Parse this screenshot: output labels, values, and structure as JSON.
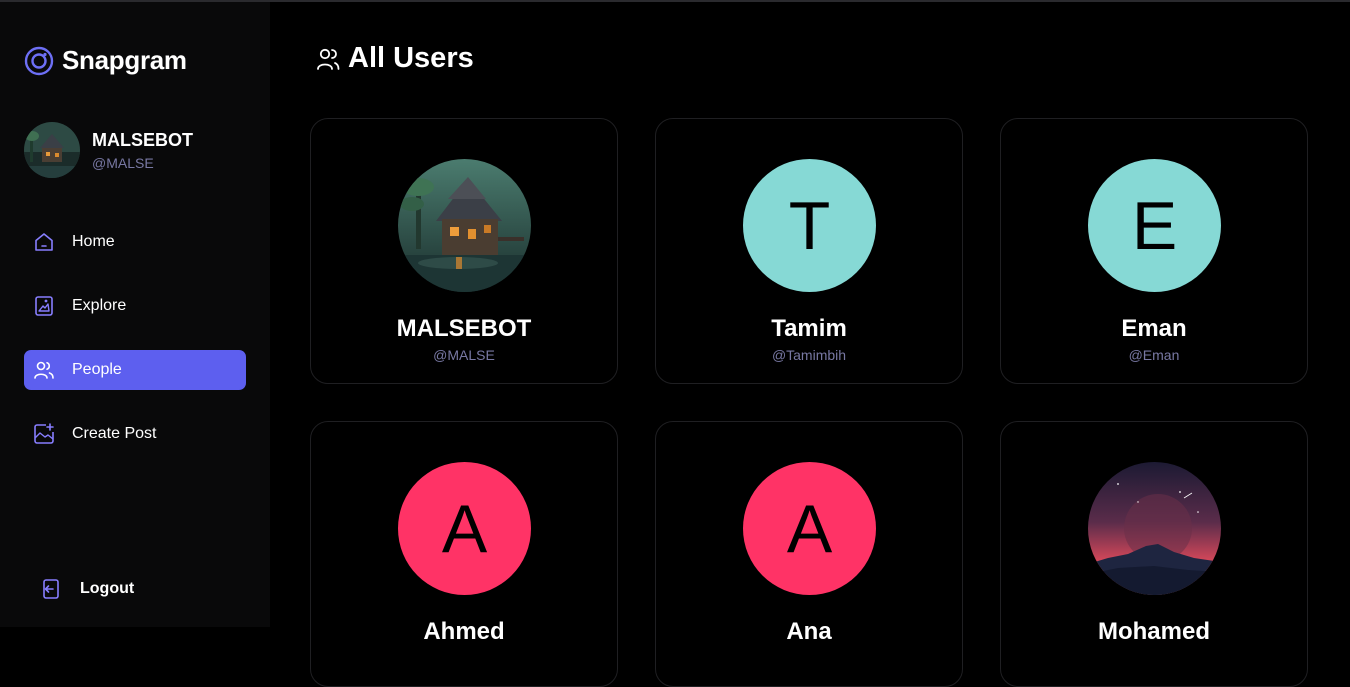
{
  "app": {
    "name": "Snapgram"
  },
  "profile": {
    "name": "MALSEBOT",
    "handle": "@MALSE"
  },
  "nav": {
    "items": [
      {
        "label": "Home",
        "icon": "home-icon",
        "active": false
      },
      {
        "label": "Explore",
        "icon": "explore-icon",
        "active": false
      },
      {
        "label": "People",
        "icon": "people-icon",
        "active": true
      },
      {
        "label": "Create Post",
        "icon": "create-post-icon",
        "active": false
      }
    ],
    "logout": "Logout"
  },
  "page": {
    "title": "All Users",
    "icon": "people-icon"
  },
  "users": [
    {
      "name": "MALSEBOT",
      "handle": "@MALSE",
      "avatar": "image",
      "initial": ""
    },
    {
      "name": "Tamim",
      "handle": "@Tamimbih",
      "avatar": "initial",
      "initial": "T",
      "color": "#86d9d5"
    },
    {
      "name": "Eman",
      "handle": "@Eman",
      "avatar": "initial",
      "initial": "E",
      "color": "#86d9d5"
    },
    {
      "name": "Ahmed",
      "handle": "",
      "avatar": "initial",
      "initial": "A",
      "color": "#ff3366"
    },
    {
      "name": "Ana",
      "handle": "",
      "avatar": "initial",
      "initial": "A",
      "color": "#ff3366"
    },
    {
      "name": "Mohamed",
      "handle": "",
      "avatar": "image",
      "initial": ""
    }
  ],
  "colors": {
    "accent": "#5d5fef",
    "handle": "#7878a3",
    "sidebar": "#09090a",
    "background": "#000000"
  }
}
